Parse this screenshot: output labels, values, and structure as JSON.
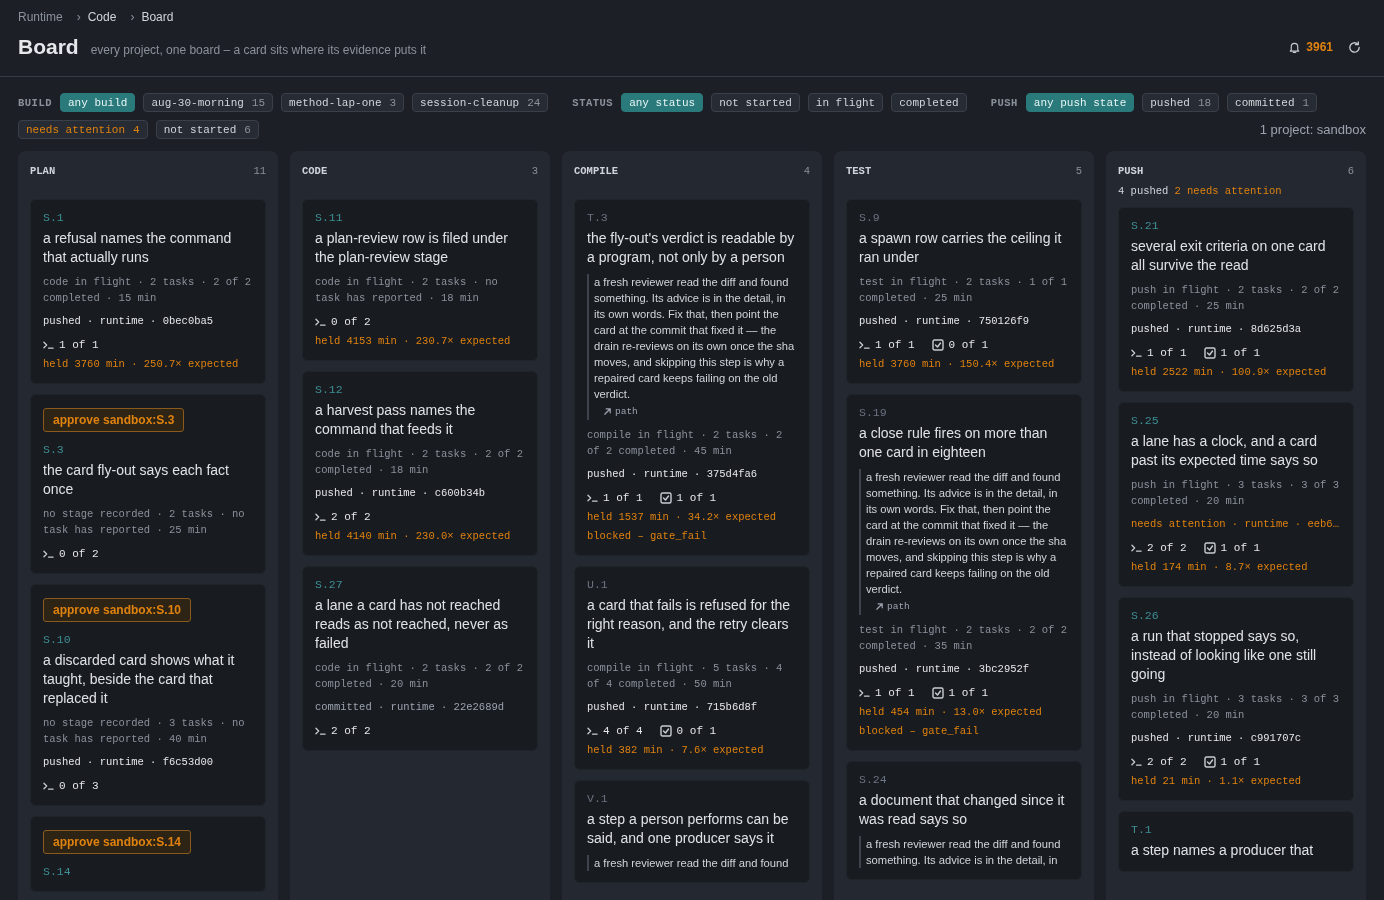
{
  "breadcrumb": {
    "items": [
      "Runtime",
      "Code",
      "Board"
    ],
    "separator": "›"
  },
  "header": {
    "title": "Board",
    "subtitle": "every project, one board – a card sits where its evidence puts it",
    "alerts": "3961"
  },
  "filters": [
    {
      "label": "BUILD",
      "chips": [
        {
          "label": "any build",
          "selected": true,
          "kind": "plain"
        },
        {
          "label": "aug-30-morning",
          "count": "15",
          "selected": false,
          "kind": "plain"
        },
        {
          "label": "method-lap-one",
          "count": "3",
          "selected": false,
          "kind": "plain"
        },
        {
          "label": "session-cleanup",
          "count": "24",
          "selected": false,
          "kind": "plain"
        }
      ]
    },
    {
      "label": "STATUS",
      "chips": [
        {
          "label": "any status",
          "selected": true,
          "kind": "plain"
        },
        {
          "label": "not started",
          "selected": false,
          "kind": "plain"
        },
        {
          "label": "in flight",
          "selected": false,
          "kind": "plain"
        },
        {
          "label": "completed",
          "selected": false,
          "kind": "plain"
        }
      ]
    },
    {
      "label": "PUSH",
      "chips": [
        {
          "label": "any push state",
          "selected": true,
          "kind": "plain"
        },
        {
          "label": "pushed",
          "count": "18",
          "selected": false,
          "kind": "plain"
        },
        {
          "label": "committed",
          "count": "1",
          "selected": false,
          "kind": "plain"
        },
        {
          "label": "needs attention",
          "count": "4",
          "selected": false,
          "kind": "attention"
        },
        {
          "label": "not started",
          "count": "6",
          "selected": false,
          "kind": "plain"
        }
      ]
    }
  ],
  "project_summary": "1 project: sandbox",
  "columns": [
    {
      "title": "PLAN",
      "count": "11",
      "cards": [
        {
          "id": "S.1",
          "color": "#3d8f94",
          "title": "a refusal names the command that actually runs",
          "meta": "code in flight · 2 tasks · 2 of 2 completed · 15 min",
          "push": {
            "text": "pushed · runtime · 0bec0ba5",
            "kind": "pushed"
          },
          "runs": "1 of 1",
          "held": "held 3760 min · 250.7× expected"
        },
        {
          "approve": "approve sandbox:S.3",
          "id": "S.3",
          "color": "#3d8f94",
          "title": "the card fly-out says each fact once",
          "meta": "no stage recorded · 2 tasks · no task has reported · 25 min",
          "runs": "0 of 2"
        },
        {
          "approve": "approve sandbox:S.10",
          "id": "S.10",
          "color": "#3d8f94",
          "title": "a discarded card shows what it taught, beside the card that replaced it",
          "meta": "no stage recorded · 3 tasks · no task has reported · 40 min",
          "push": {
            "text": "pushed · runtime · f6c53d00",
            "kind": "pushed"
          },
          "runs": "0 of 3"
        },
        {
          "approve": "approve sandbox:S.14",
          "id": "S.14",
          "color": "#3d8f94"
        }
      ]
    },
    {
      "title": "CODE",
      "count": "3",
      "cards": [
        {
          "id": "S.11",
          "color": "#3d8f94",
          "title": "a plan-review row is filed under the plan-review stage",
          "meta": "code in flight · 2 tasks · no task has reported · 18 min",
          "runs": "0 of 2",
          "held": "held 4153 min · 230.7× expected"
        },
        {
          "id": "S.12",
          "color": "#3d8f94",
          "title": "a harvest pass names the command that feeds it",
          "meta": "code in flight · 2 tasks · 2 of 2 completed · 18 min",
          "push": {
            "text": "pushed · runtime · c600b34b",
            "kind": "pushed"
          },
          "runs": "2 of 2",
          "held": "held 4140 min · 230.0× expected"
        },
        {
          "id": "S.27",
          "color": "#3d8f94",
          "title": "a lane a card has not reached reads as not reached, never as failed",
          "meta": "code in flight · 2 tasks · 2 of 2 completed · 20 min",
          "push": {
            "text": "committed · runtime · 22e2689d",
            "kind": "committed"
          },
          "runs": "2 of 2"
        }
      ]
    },
    {
      "title": "COMPILE",
      "count": "4",
      "cards": [
        {
          "id": "T.3",
          "color": "#6b7280",
          "title": "the fly-out's verdict is readable by a program, not only by a person",
          "note": "a fresh reviewer read the diff and found something. Its advice is in the detail, in its own words. Fix that, then point the card at the commit that fixed it — the drain re-reviews on its own once the sha moves, and skipping this step is why a repaired card keeps failing on the old verdict.",
          "note_link": "path",
          "meta": "compile in flight · 2 tasks · 2 of 2 completed · 45 min",
          "push": {
            "text": "pushed · runtime · 375d4fa6",
            "kind": "pushed"
          },
          "runs": "1 of 1",
          "checks": "1 of 1",
          "held": "held 1537 min · 34.2× expected",
          "blocked": "blocked – gate_fail"
        },
        {
          "id": "U.1",
          "color": "#6b7280",
          "title": "a card that fails is refused for the right reason, and the retry clears it",
          "meta": "compile in flight · 5 tasks · 4 of 4 completed · 50 min",
          "push": {
            "text": "pushed · runtime · 715b6d8f",
            "kind": "pushed"
          },
          "runs": "4 of 4",
          "checks": "0 of 1",
          "held": "held 382 min · 7.6× expected"
        },
        {
          "id": "V.1",
          "color": "#6b7280",
          "title": "a step a person performs can be said, and one producer says it",
          "note": "a fresh reviewer read the diff and found"
        }
      ]
    },
    {
      "title": "TEST",
      "count": "5",
      "cards": [
        {
          "id": "S.9",
          "color": "#6b7280",
          "title": "a spawn row carries the ceiling it ran under",
          "meta": "test in flight · 2 tasks · 1 of 1 completed · 25 min",
          "push": {
            "text": "pushed · runtime · 750126f9",
            "kind": "pushed"
          },
          "runs": "1 of 1",
          "checks": "0 of 1",
          "held": "held 3760 min · 150.4× expected"
        },
        {
          "id": "S.19",
          "color": "#6b7280",
          "title": "a close rule fires on more than one card in eighteen",
          "note": "a fresh reviewer read the diff and found something. Its advice is in the detail, in its own words. Fix that, then point the card at the commit that fixed it — the drain re-reviews on its own once the sha moves, and skipping this step is why a repaired card keeps failing on the old verdict.",
          "note_link": "path",
          "meta": "test in flight · 2 tasks · 2 of 2 completed · 35 min",
          "push": {
            "text": "pushed · runtime · 3bc2952f",
            "kind": "pushed"
          },
          "runs": "1 of 1",
          "checks": "1 of 1",
          "held": "held 454 min · 13.0× expected",
          "blocked": "blocked – gate_fail"
        },
        {
          "id": "S.24",
          "color": "#6b7280",
          "title": "a document that changed since it was read says so",
          "note": "a fresh reviewer read the diff and found something. Its advice is in the detail, in"
        }
      ]
    },
    {
      "title": "PUSH",
      "count": "6",
      "summary": [
        {
          "text": "4 pushed",
          "kind": "pushed"
        },
        {
          "text": "2 needs attention",
          "kind": "attention"
        }
      ],
      "cards": [
        {
          "id": "S.21",
          "color": "#3d8f94",
          "title": "several exit criteria on one card all survive the read",
          "meta": "push in flight · 2 tasks · 2 of 2 completed · 25 min",
          "push": {
            "text": "pushed · runtime · 8d625d3a",
            "kind": "pushed"
          },
          "runs": "1 of 1",
          "checks": "1 of 1",
          "held": "held 2522 min · 100.9× expected"
        },
        {
          "id": "S.25",
          "color": "#3d8f94",
          "title": "a lane has a clock, and a card past its expected time says so",
          "meta": "push in flight · 3 tasks · 3 of 3 completed · 20 min",
          "push": {
            "text": "needs attention · runtime · eeb6…",
            "kind": "attention"
          },
          "runs": "2 of 2",
          "checks": "1 of 1",
          "held": "held 174 min · 8.7× expected"
        },
        {
          "id": "S.26",
          "color": "#3d8f94",
          "title": "a run that stopped says so, instead of looking like one still going",
          "meta": "push in flight · 3 tasks · 3 of 3 completed · 20 min",
          "push": {
            "text": "pushed · runtime · c991707c",
            "kind": "pushed"
          },
          "runs": "2 of 2",
          "checks": "1 of 1",
          "held": "held 21 min · 1.1× expected"
        },
        {
          "id": "T.1",
          "color": "#3d8f94",
          "title": "a step names a producer that"
        }
      ]
    }
  ]
}
